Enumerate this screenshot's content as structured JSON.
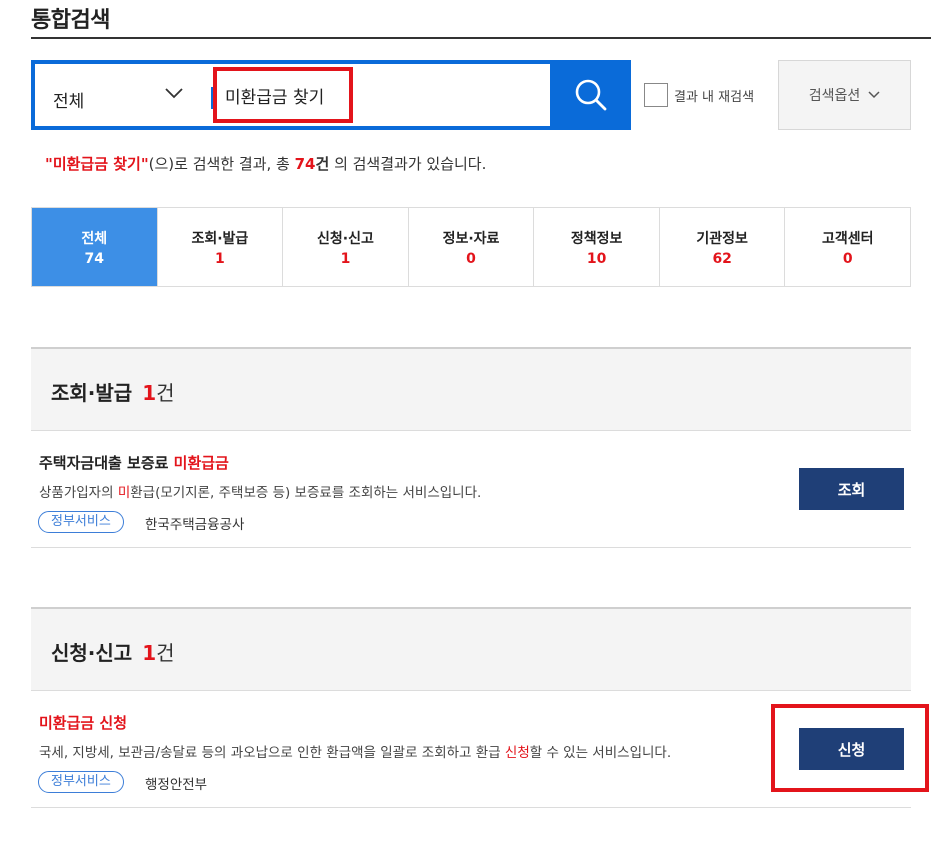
{
  "page": {
    "title": "통합검색"
  },
  "search": {
    "category": "전체",
    "query": "미환급금 찾기",
    "recheck_label": "결과 내 재검색",
    "options_label": "검색옵션"
  },
  "summary": {
    "query_quoted": "\"미환급금 찾기\"",
    "middle_text": "(으)로 검색한 결과, 총 ",
    "total": "74",
    "unit": "건",
    "tail_text": " 의 검색결과가 있습니다."
  },
  "tabs": [
    {
      "label": "전체",
      "count": "74"
    },
    {
      "label": "조회·발급",
      "count": "1"
    },
    {
      "label": "신청·신고",
      "count": "1"
    },
    {
      "label": "정보·자료",
      "count": "0"
    },
    {
      "label": "정책정보",
      "count": "10"
    },
    {
      "label": "기관정보",
      "count": "62"
    },
    {
      "label": "고객센터",
      "count": "0"
    }
  ],
  "sections": [
    {
      "title": "조회·발급",
      "count": "1",
      "unit": "건",
      "item": {
        "title_prefix": "주택자금대출 보증료 ",
        "title_highlight": "미환급금",
        "desc_prefix": "상품가입자의 ",
        "desc_highlight": "미",
        "desc_suffix": "환급(모기지론, 주택보증 등) 보증료를 조회하는 서비스입니다.",
        "tag": "정부서비스",
        "org": "한국주택금융공사",
        "button": "조회"
      }
    },
    {
      "title": "신청·신고",
      "count": "1",
      "unit": "건",
      "item": {
        "title_highlight": "미환급금 신청",
        "desc_prefix": "국세, 지방세, 보관금/송달료 등의 과오납으로 인한 환급액을 일괄로 조회하고 환급 ",
        "desc_highlight": "신청",
        "desc_suffix": "할 수 있는 서비스입니다.",
        "tag": "정부서비스",
        "org": "행정안전부",
        "button": "신청"
      }
    }
  ],
  "colors": {
    "brand_blue": "#0a6bd9",
    "active_tab": "#3d8fe6",
    "highlight_red": "#e3141b",
    "button_navy": "#1f3f77"
  },
  "icons": [
    "chevron-down-icon",
    "search-icon"
  ]
}
